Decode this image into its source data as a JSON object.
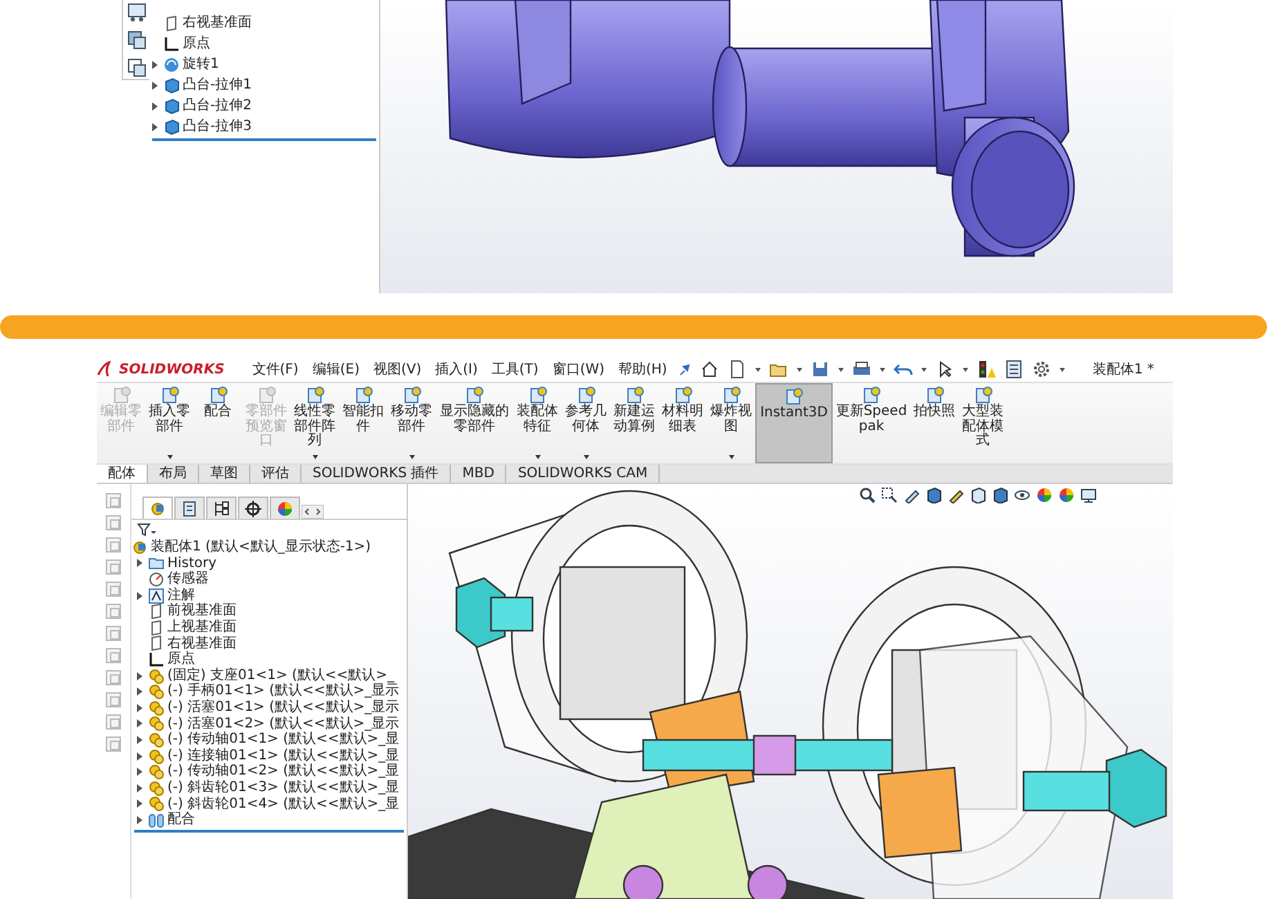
{
  "top_panel": {
    "tree": [
      {
        "label": "右视基准面",
        "kind": "plane",
        "expandable": false
      },
      {
        "label": "原点",
        "kind": "origin",
        "expandable": false
      },
      {
        "label": "旋转1",
        "kind": "revolve",
        "expandable": true
      },
      {
        "label": "凸台-拉伸1",
        "kind": "extrude",
        "expandable": true
      },
      {
        "label": "凸台-拉伸2",
        "kind": "extrude",
        "expandable": true
      },
      {
        "label": "凸台-拉伸3",
        "kind": "extrude",
        "expandable": true
      }
    ]
  },
  "bottom_panel": {
    "brand": "SOLIDWORKS",
    "menu": [
      "文件(F)",
      "编辑(E)",
      "视图(V)",
      "插入(I)",
      "工具(T)",
      "窗口(W)",
      "帮助(H)"
    ],
    "window_title": "装配体1 *",
    "ribbon": [
      {
        "label": "编辑零部件",
        "disabled": true,
        "dropdown": false,
        "selected": false
      },
      {
        "label": "插入零部件",
        "disabled": false,
        "dropdown": true,
        "selected": false
      },
      {
        "label": "配合",
        "disabled": false,
        "dropdown": false,
        "selected": false
      },
      {
        "label": "零部件预览窗口",
        "disabled": true,
        "dropdown": false,
        "selected": false
      },
      {
        "label": "线性零部件阵列",
        "disabled": false,
        "dropdown": true,
        "selected": false
      },
      {
        "label": "智能扣件",
        "disabled": false,
        "dropdown": false,
        "selected": false
      },
      {
        "label": "移动零部件",
        "disabled": false,
        "dropdown": true,
        "selected": false
      },
      {
        "label": "显示隐藏的零部件",
        "disabled": false,
        "dropdown": false,
        "selected": false
      },
      {
        "label": "装配体特征",
        "disabled": false,
        "dropdown": true,
        "selected": false
      },
      {
        "label": "参考几何体",
        "disabled": false,
        "dropdown": true,
        "selected": false
      },
      {
        "label": "新建运动算例",
        "disabled": false,
        "dropdown": false,
        "selected": false
      },
      {
        "label": "材料明细表",
        "disabled": false,
        "dropdown": false,
        "selected": false
      },
      {
        "label": "爆炸视图",
        "disabled": false,
        "dropdown": true,
        "selected": false
      },
      {
        "label": "Instant3D",
        "disabled": false,
        "dropdown": false,
        "selected": true
      },
      {
        "label": "更新Speedpak",
        "disabled": false,
        "dropdown": false,
        "selected": false
      },
      {
        "label": "拍快照",
        "disabled": false,
        "dropdown": false,
        "selected": false
      },
      {
        "label": "大型装配体模式",
        "disabled": false,
        "dropdown": false,
        "selected": false
      }
    ],
    "tabs": [
      {
        "label": "配体",
        "selected": true
      },
      {
        "label": "布局",
        "selected": false
      },
      {
        "label": "草图",
        "selected": false
      },
      {
        "label": "评估",
        "selected": false
      },
      {
        "label": "SOLIDWORKS 插件",
        "selected": false
      },
      {
        "label": "MBD",
        "selected": false
      },
      {
        "label": "SOLIDWORKS CAM",
        "selected": false
      }
    ],
    "panel_tabs": [
      {
        "selected": true
      },
      {
        "selected": false
      },
      {
        "selected": false
      },
      {
        "selected": false
      },
      {
        "selected": false
      }
    ],
    "tree_root": "装配体1 (默认<默认_显示状态-1>)",
    "tree": [
      {
        "label": "History",
        "kind": "folder",
        "expandable": true
      },
      {
        "label": "传感器",
        "kind": "sensor",
        "expandable": false
      },
      {
        "label": "注解",
        "kind": "annotation",
        "expandable": true
      },
      {
        "label": "前视基准面",
        "kind": "plane",
        "expandable": false
      },
      {
        "label": "上视基准面",
        "kind": "plane",
        "expandable": false
      },
      {
        "label": "右视基准面",
        "kind": "plane",
        "expandable": false
      },
      {
        "label": "原点",
        "kind": "origin",
        "expandable": false
      },
      {
        "label": "(固定) 支座01<1> (默认<<默认>_",
        "kind": "part",
        "expandable": true
      },
      {
        "label": "(-) 手柄01<1> (默认<<默认>_显示",
        "kind": "part",
        "expandable": true
      },
      {
        "label": "(-) 活塞01<1> (默认<<默认>_显示",
        "kind": "part",
        "expandable": true
      },
      {
        "label": "(-) 活塞01<2> (默认<<默认>_显示",
        "kind": "part",
        "expandable": true
      },
      {
        "label": "(-) 传动轴01<1> (默认<<默认>_显",
        "kind": "part",
        "expandable": true
      },
      {
        "label": "(-) 连接轴01<1> (默认<<默认>_显",
        "kind": "part",
        "expandable": true
      },
      {
        "label": "(-) 传动轴01<2> (默认<<默认>_显",
        "kind": "part",
        "expandable": true
      },
      {
        "label": "(-) 斜齿轮01<3> (默认<<默认>_显",
        "kind": "part",
        "expandable": true
      },
      {
        "label": "(-) 斜齿轮01<4> (默认<<默认>_显",
        "kind": "part",
        "expandable": true
      },
      {
        "label": "配合",
        "kind": "mates",
        "expandable": true
      }
    ]
  }
}
